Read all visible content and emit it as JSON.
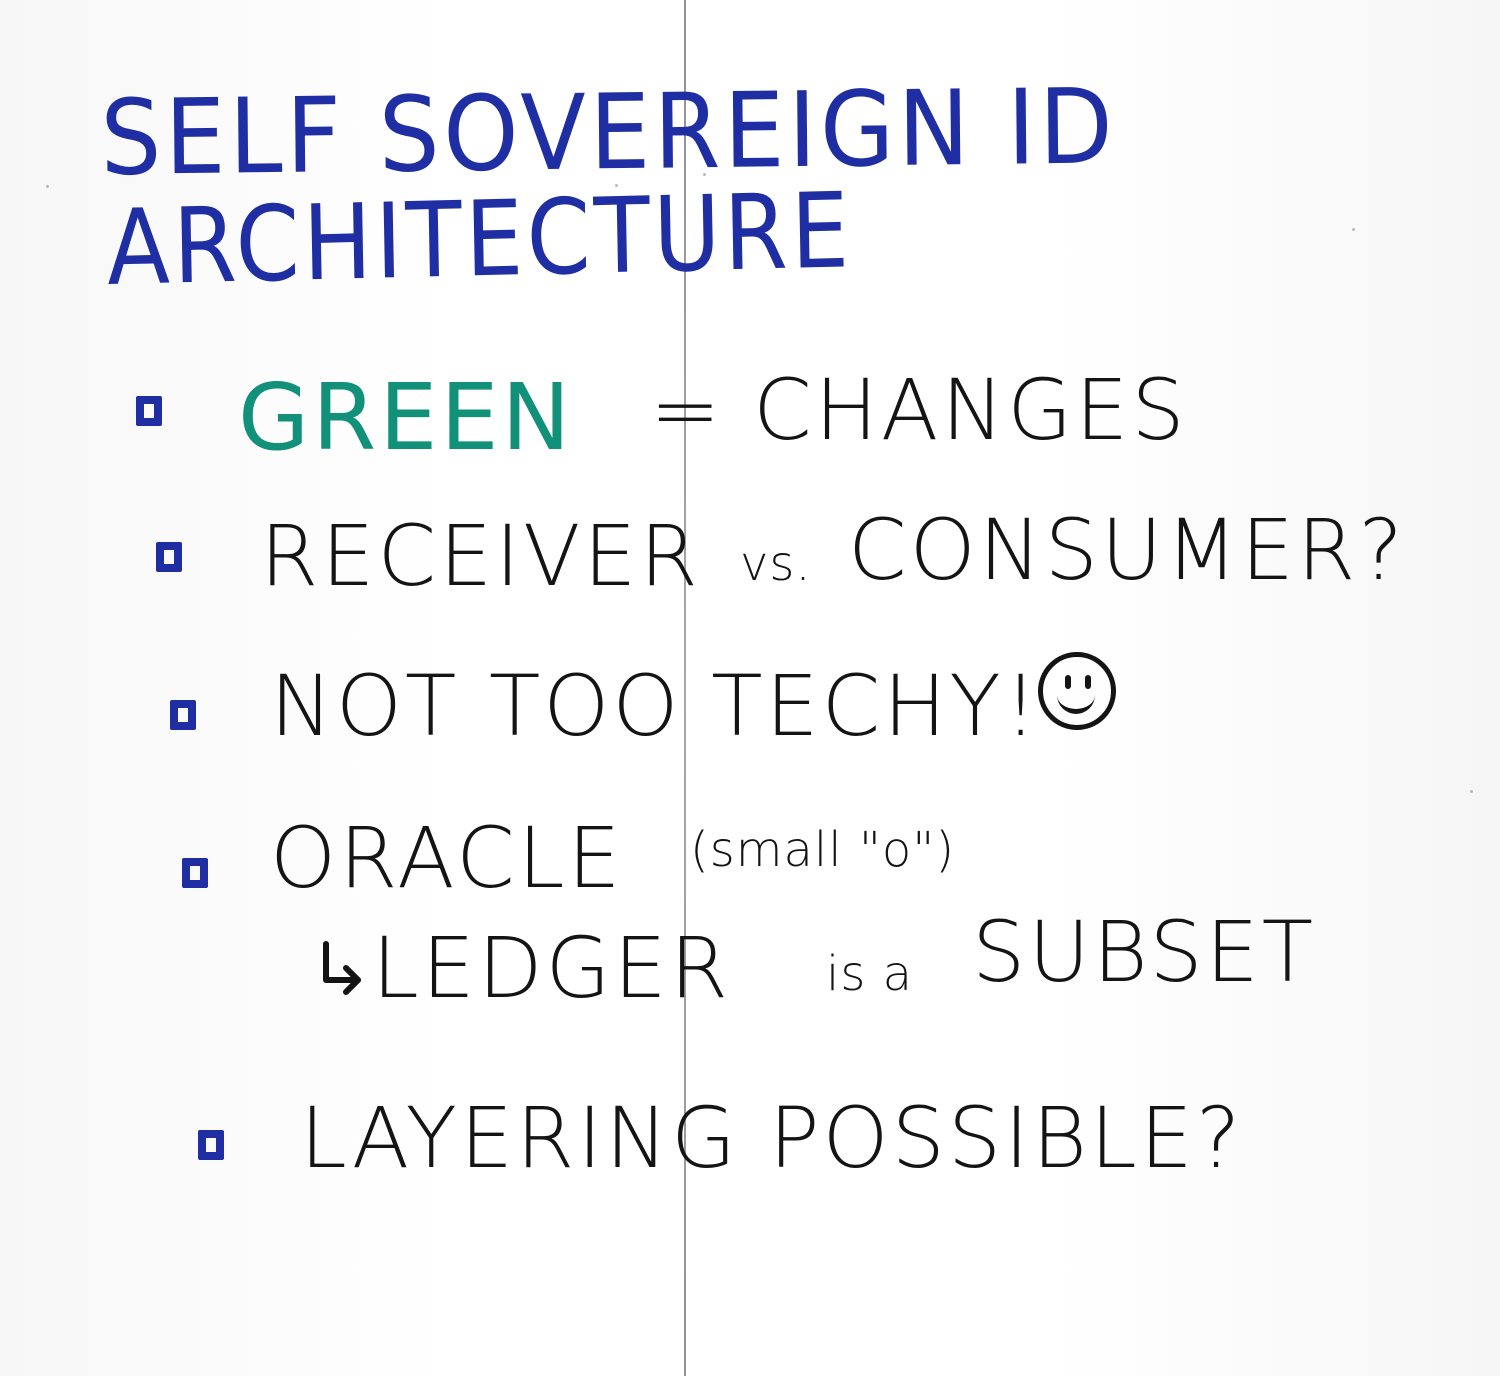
{
  "title": {
    "line1": "SELF SOVEREIGN ID",
    "line2": "ARCHITECTURE"
  },
  "items": [
    {
      "part_green": "GREEN",
      "part_rest": "= CHANGES"
    },
    {
      "text_main": "RECEIVER",
      "text_small": "vs.",
      "text_end": "CONSUMER?"
    },
    {
      "text": "NOT TOO TECHY!"
    },
    {
      "text_main": "ORACLE",
      "text_small": "(small \"o\")"
    },
    {
      "sub_main": "LEDGER",
      "sub_small": "is a",
      "sub_end": "SUBSET"
    },
    {
      "text": "LAYERING POSSIBLE?"
    }
  ],
  "icons": {
    "checkbox": "square-checkbox-icon",
    "smiley": "smiley-face-icon",
    "arrow": "return-arrow-icon"
  },
  "colors": {
    "title_blue": "#1f2fa3",
    "green": "#11907a",
    "ink": "#141414",
    "board": "#fbfbfb"
  }
}
